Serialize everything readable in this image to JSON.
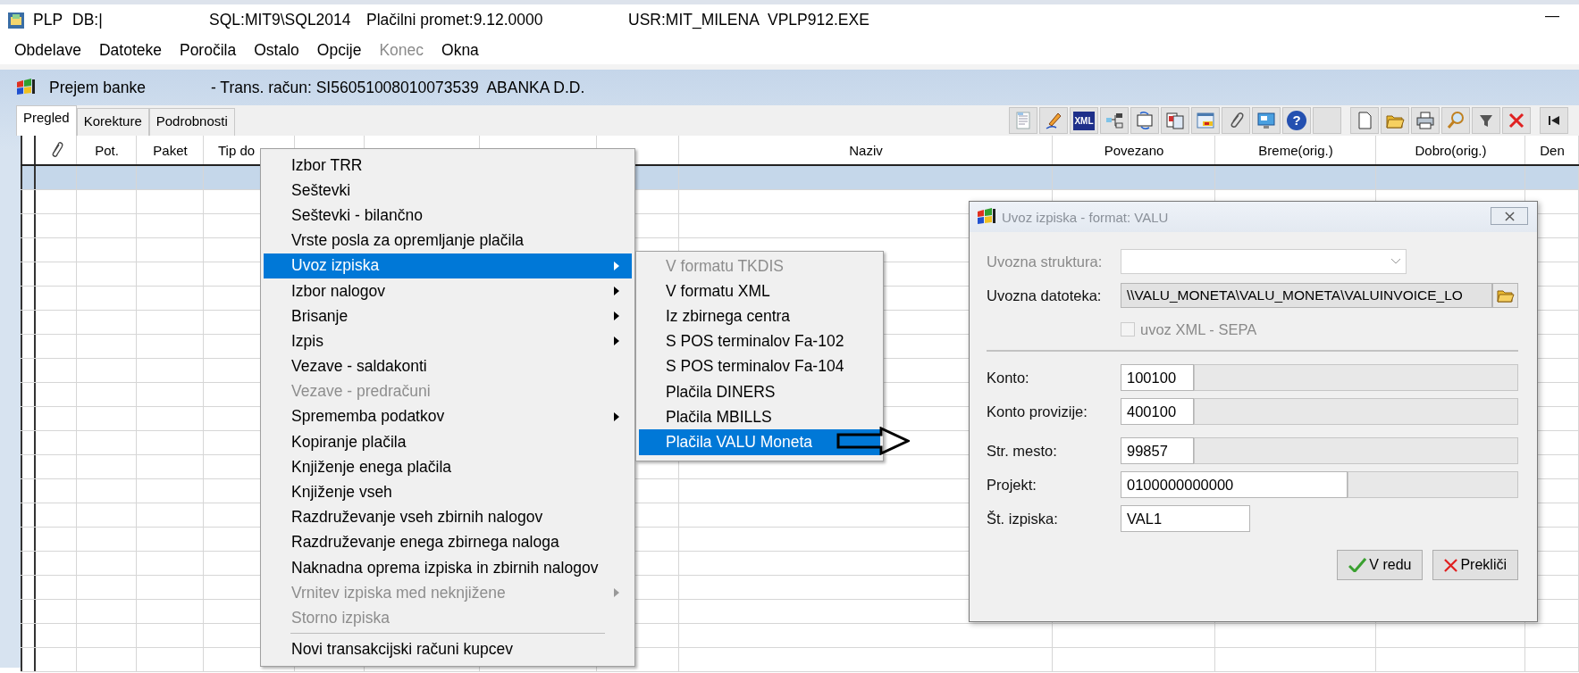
{
  "title_bar": {
    "items": [
      "PLP",
      "DB:|",
      "SQL:MIT9\\SQL2014",
      "Plačilni promet:9.12.0000",
      "USR:MIT_MILENA",
      "VPLP912.EXE"
    ],
    "minimize": "—"
  },
  "menu_bar": [
    {
      "label": "Obdelave",
      "disabled": false
    },
    {
      "label": "Datoteke",
      "disabled": false
    },
    {
      "label": "Poročila",
      "disabled": false
    },
    {
      "label": "Ostalo",
      "disabled": false
    },
    {
      "label": "Opcije",
      "disabled": false
    },
    {
      "label": "Konec",
      "disabled": true
    },
    {
      "label": "Okna",
      "disabled": false
    }
  ],
  "document": {
    "title": "Prejem banke",
    "account": "- Trans. račun: SI56051008010073539  ABANKA D.D."
  },
  "tabs": [
    {
      "label": "Pregled",
      "selected": true
    },
    {
      "label": "Korekture",
      "selected": false
    },
    {
      "label": "Podrobnosti",
      "selected": false
    }
  ],
  "toolbar": [
    {
      "kind": "report"
    },
    {
      "kind": "pencil"
    },
    {
      "kind": "xml",
      "label": "XML"
    },
    {
      "kind": "tree"
    },
    {
      "kind": "transfer"
    },
    {
      "kind": "documents"
    },
    {
      "kind": "window"
    },
    {
      "kind": "clip"
    },
    {
      "kind": "display"
    },
    {
      "kind": "help",
      "label": "?"
    },
    {
      "kind": "blank"
    },
    {
      "kind": "new"
    },
    {
      "kind": "open"
    },
    {
      "kind": "print"
    },
    {
      "kind": "search"
    },
    {
      "kind": "filter"
    },
    {
      "kind": "delete"
    },
    {
      "kind": "first"
    }
  ],
  "table": {
    "columns": [
      "Pot.",
      "Paket",
      "Tip do",
      "Naziv",
      "Povezano",
      "Breme(orig.)",
      "Dobro(orig.)",
      "Den"
    ],
    "rows": [
      {
        "selected": true
      },
      {
        "selected": false
      },
      {
        "selected": false
      },
      {
        "selected": false
      },
      {
        "selected": false
      },
      {
        "selected": false
      },
      {
        "selected": false
      },
      {
        "selected": false
      },
      {
        "selected": false
      },
      {
        "selected": false
      },
      {
        "selected": false
      },
      {
        "selected": false
      },
      {
        "selected": false
      },
      {
        "selected": false
      },
      {
        "selected": false
      },
      {
        "selected": false
      },
      {
        "selected": false
      },
      {
        "selected": false
      },
      {
        "selected": false
      },
      {
        "selected": false
      },
      {
        "selected": false
      }
    ]
  },
  "context_menu": {
    "items": [
      {
        "label": "Izbor TRR",
        "selected": false,
        "disabled": false,
        "submenu": false,
        "separator_before": false
      },
      {
        "label": "Seštevki",
        "selected": false,
        "disabled": false,
        "submenu": false,
        "separator_before": false
      },
      {
        "label": "Seštevki - bilančno",
        "selected": false,
        "disabled": false,
        "submenu": false,
        "separator_before": false
      },
      {
        "label": "Vrste posla za opremljanje plačila",
        "selected": false,
        "disabled": false,
        "submenu": false,
        "separator_before": false
      },
      {
        "label": "Uvoz izpiska",
        "selected": true,
        "disabled": false,
        "submenu": true,
        "separator_before": false
      },
      {
        "label": "Izbor nalogov",
        "selected": false,
        "disabled": false,
        "submenu": true,
        "separator_before": false
      },
      {
        "label": "Brisanje",
        "selected": false,
        "disabled": false,
        "submenu": true,
        "separator_before": false
      },
      {
        "label": "Izpis",
        "selected": false,
        "disabled": false,
        "submenu": true,
        "separator_before": false
      },
      {
        "label": "Vezave - saldakonti",
        "selected": false,
        "disabled": false,
        "submenu": false,
        "separator_before": false
      },
      {
        "label": "Vezave - predračuni",
        "selected": false,
        "disabled": true,
        "submenu": false,
        "separator_before": false
      },
      {
        "label": "Sprememba podatkov",
        "selected": false,
        "disabled": false,
        "submenu": true,
        "separator_before": false
      },
      {
        "label": "Kopiranje plačila",
        "selected": false,
        "disabled": false,
        "submenu": false,
        "separator_before": false
      },
      {
        "label": "Knjiženje enega plačila",
        "selected": false,
        "disabled": false,
        "submenu": false,
        "separator_before": false
      },
      {
        "label": "Knjiženje vseh",
        "selected": false,
        "disabled": false,
        "submenu": false,
        "separator_before": false
      },
      {
        "label": "Razdruževanje vseh zbirnih nalogov",
        "selected": false,
        "disabled": false,
        "submenu": false,
        "separator_before": false
      },
      {
        "label": "Razdruževanje enega zbirnega naloga",
        "selected": false,
        "disabled": false,
        "submenu": false,
        "separator_before": false
      },
      {
        "label": "Naknadna oprema izpiska in zbirnih nalogov",
        "selected": false,
        "disabled": false,
        "submenu": false,
        "separator_before": false
      },
      {
        "label": "Vrnitev izpiska med neknjižene",
        "selected": false,
        "disabled": true,
        "submenu": true,
        "separator_before": false
      },
      {
        "label": "Storno izpiska",
        "selected": false,
        "disabled": true,
        "submenu": false,
        "separator_before": false
      },
      {
        "label": "Novi transakcijski računi kupcev",
        "selected": false,
        "disabled": false,
        "submenu": false,
        "separator_before": true
      }
    ]
  },
  "submenu": {
    "items": [
      {
        "label": "V formatu TKDIS",
        "selected": false,
        "disabled": true
      },
      {
        "label": "V formatu XML",
        "selected": false,
        "disabled": false
      },
      {
        "label": "Iz zbirnega centra",
        "selected": false,
        "disabled": false
      },
      {
        "label": "S POS terminalov Fa-102",
        "selected": false,
        "disabled": false
      },
      {
        "label": "S POS terminalov Fa-104",
        "selected": false,
        "disabled": false
      },
      {
        "label": "Plačila DINERS",
        "selected": false,
        "disabled": false
      },
      {
        "label": "Plačila MBILLS",
        "selected": false,
        "disabled": false
      },
      {
        "label": "Plačila VALU Moneta",
        "selected": true,
        "disabled": false
      }
    ]
  },
  "dialog": {
    "title": "Uvoz izpiska - format: VALU",
    "import_fields": [
      {
        "label": "Uvozna struktura:",
        "kind": "combo",
        "disabled": true
      },
      {
        "label": "Uvozna datoteka:",
        "kind": "file",
        "value": "\\\\VALU_MONETA\\VALU_MONETA\\VALUINVOICE_LO",
        "disabled": false
      }
    ],
    "checkbox": {
      "label": "uvoz XML - SEPA",
      "checked": false,
      "disabled": true
    },
    "field_groups": [
      [
        {
          "label": "Konto:",
          "kind": "code",
          "value": "100100"
        },
        {
          "label": "Konto provizije:",
          "kind": "code",
          "value": "400100"
        }
      ],
      [
        {
          "label": "Str. mesto:",
          "kind": "code",
          "value": "99857"
        },
        {
          "label": "Projekt:",
          "kind": "project",
          "value": "0100000000000"
        },
        {
          "label": "Št. izpiska:",
          "kind": "plain",
          "value": "VAL1"
        }
      ]
    ],
    "buttons": [
      {
        "label": "V redu",
        "kind": "ok"
      },
      {
        "label": "Prekliči",
        "kind": "cancel"
      }
    ]
  }
}
